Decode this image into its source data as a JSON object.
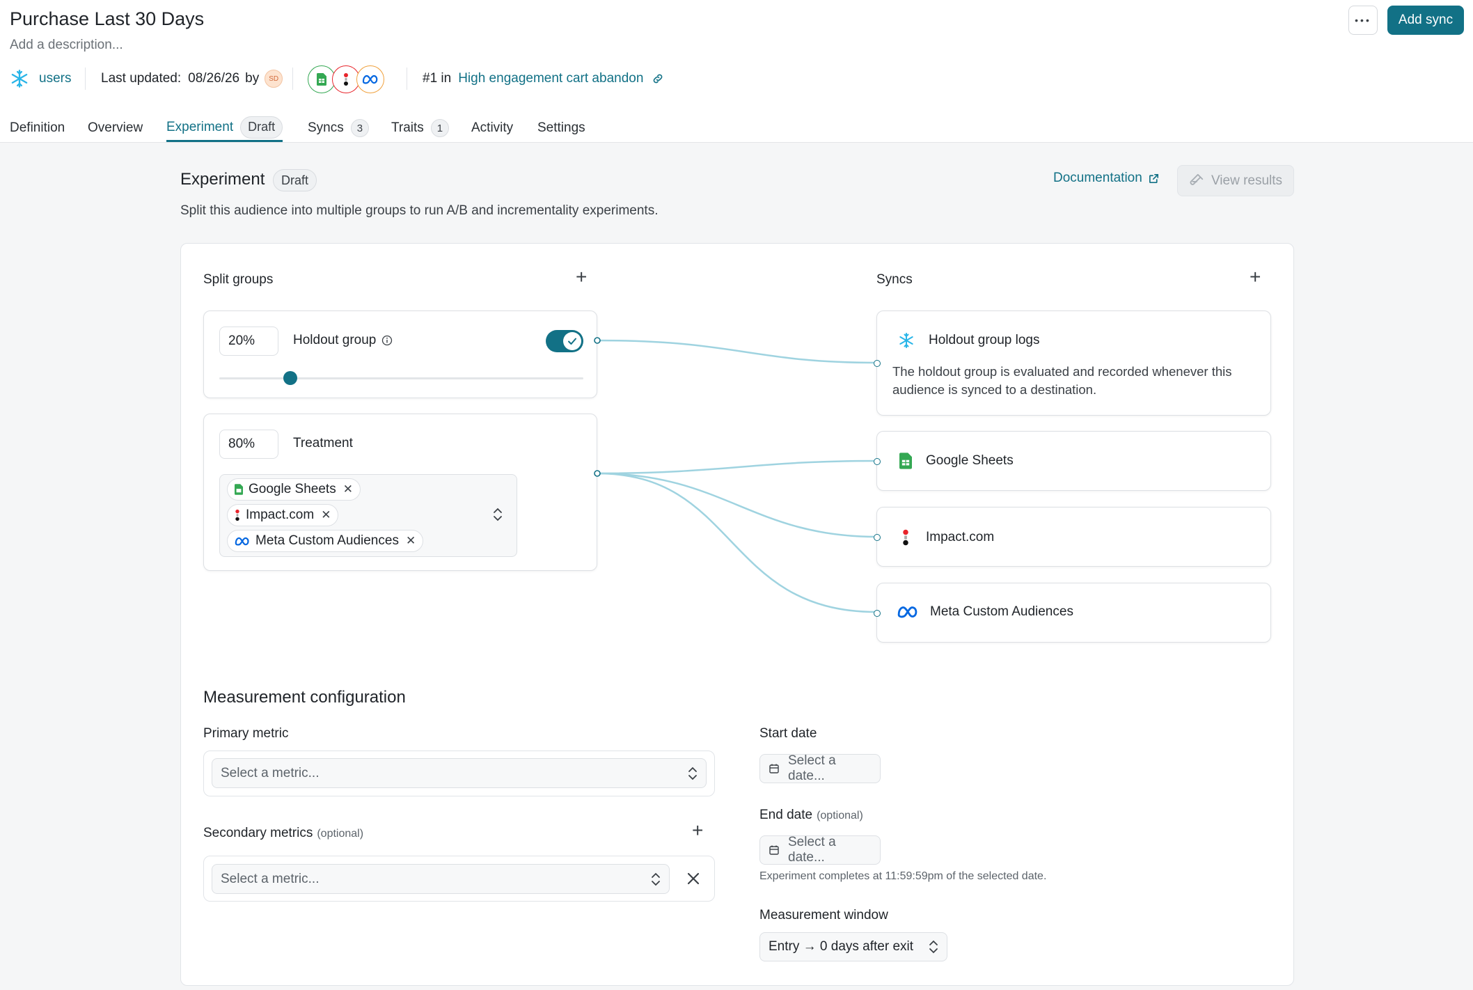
{
  "page": {
    "title": "Purchase Last 30 Days",
    "description_placeholder": "Add a description...",
    "more_label": "•••",
    "add_sync_label": "Add sync"
  },
  "meta": {
    "source_label": "users",
    "last_updated_label": "Last updated:",
    "last_updated_date": "08/26/26",
    "by_label": "by",
    "avatar_initials": "SD",
    "rank_label": "#1 in",
    "rank_link": "High engagement cart abandon"
  },
  "tabs": [
    {
      "label": "Definition"
    },
    {
      "label": "Overview"
    },
    {
      "label": "Experiment",
      "badge": "Draft"
    },
    {
      "label": "Syncs",
      "badge": "3"
    },
    {
      "label": "Traits",
      "badge": "1"
    },
    {
      "label": "Activity"
    },
    {
      "label": "Settings"
    }
  ],
  "experiment": {
    "title": "Experiment",
    "status": "Draft",
    "subtitle": "Split this audience into multiple groups to run A/B and incrementality experiments.",
    "documentation_label": "Documentation",
    "view_results_label": "View results"
  },
  "split_groups": {
    "label": "Split groups",
    "holdout": {
      "percent": "20%",
      "name": "Holdout group",
      "enabled": true,
      "slider_fraction": 0.2
    },
    "treatment": {
      "percent": "80%",
      "name": "Treatment",
      "destinations": [
        "Google Sheets",
        "Impact.com",
        "Meta Custom Audiences"
      ]
    }
  },
  "syncs": {
    "label": "Syncs",
    "items": [
      {
        "name": "Holdout group logs",
        "description": "The holdout group is evaluated and recorded whenever this audience is synced to a destination.",
        "icon": "snowflake-icon"
      },
      {
        "name": "Google Sheets",
        "icon": "google-sheets-icon"
      },
      {
        "name": "Impact.com",
        "icon": "impact-icon"
      },
      {
        "name": "Meta Custom Audiences",
        "icon": "meta-icon"
      }
    ]
  },
  "measurement": {
    "title": "Measurement configuration",
    "primary_metric_label": "Primary metric",
    "primary_metric_placeholder": "Select a metric...",
    "secondary_metrics_label": "Secondary metrics",
    "optional_label": "(optional)",
    "secondary_metric_placeholder": "Select a metric...",
    "start_date_label": "Start date",
    "start_date_placeholder": "Select a date...",
    "end_date_label": "End date",
    "end_date_placeholder": "Select a date...",
    "end_date_hint": "Experiment completes at 11:59:59pm of the selected date.",
    "window_label": "Measurement window",
    "window_value": "Entry → 0 days after exit"
  },
  "colors": {
    "accent": "#127186",
    "connector": "#9fd3e0",
    "sheets_green": "#34a853",
    "meta_blue": "#0668e1",
    "impact_red": "#e8242b"
  }
}
